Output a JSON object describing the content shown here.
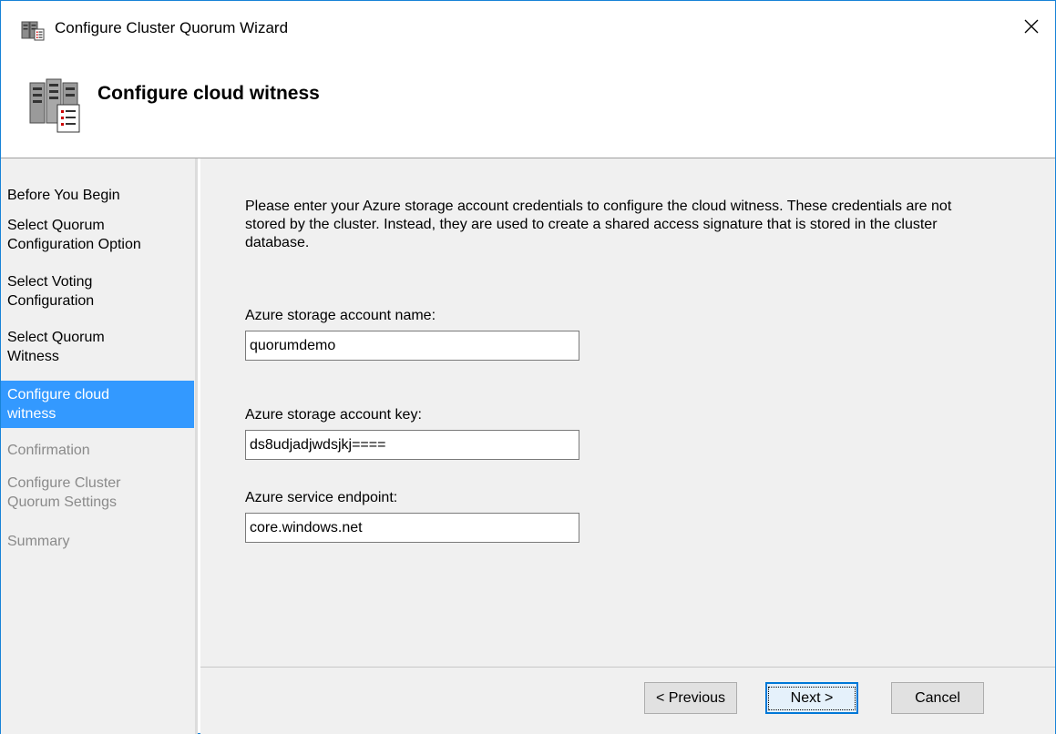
{
  "window": {
    "title": "Configure Cluster Quorum Wizard",
    "accent": "#1883d7"
  },
  "header": {
    "title": "Configure cloud witness"
  },
  "nav": {
    "items": [
      {
        "label": "Before You Begin",
        "state": "normal"
      },
      {
        "label": "Select Quorum\nConfiguration Option",
        "state": "normal"
      },
      {
        "label": "Select Voting\nConfiguration",
        "state": "normal"
      },
      {
        "label": "Select Quorum\nWitness",
        "state": "normal"
      },
      {
        "label": "Configure cloud\nwitness",
        "state": "selected"
      },
      {
        "label": "Confirmation",
        "state": "disabled"
      },
      {
        "label": "Configure Cluster\nQuorum Settings",
        "state": "disabled"
      },
      {
        "label": "Summary",
        "state": "disabled"
      }
    ],
    "selected_color": "#3399ff"
  },
  "content": {
    "intro": "Please enter your Azure storage account credentials to configure the cloud witness. These credentials are not stored by the cluster. Instead, they are used to create a shared access signature that is stored in the cluster database.",
    "fields": {
      "account_name": {
        "label": "Azure storage account name:",
        "value": "quorumdemo"
      },
      "account_key": {
        "label": "Azure storage account key:",
        "value": "ds8udjadjwdsjkj===="
      },
      "endpoint": {
        "label": "Azure service endpoint:",
        "value": "core.windows.net"
      }
    }
  },
  "buttons": {
    "previous": "< Previous",
    "next": "Next >",
    "cancel": "Cancel"
  },
  "icons": {
    "app": "cluster-wizard-icon",
    "header": "cluster-server-icon",
    "close": "close-icon"
  }
}
